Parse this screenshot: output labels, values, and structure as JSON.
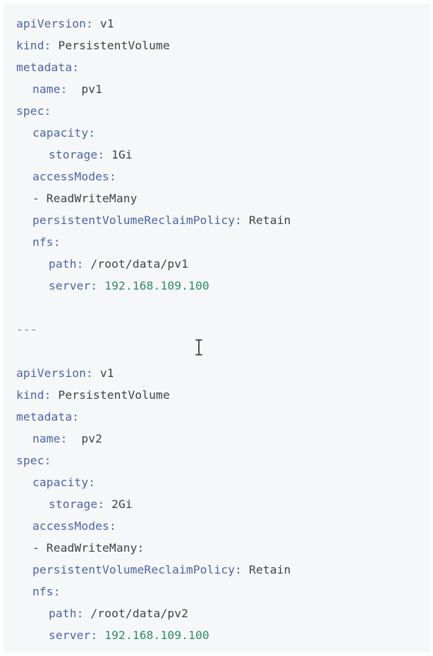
{
  "documents": [
    {
      "lines": [
        {
          "indent": 0,
          "key": "apiVersion",
          "sep": ": ",
          "value": "v1",
          "value_kind": "text"
        },
        {
          "indent": 0,
          "key": "kind",
          "sep": ": ",
          "value": "PersistentVolume",
          "value_kind": "text"
        },
        {
          "indent": 0,
          "key": "metadata",
          "sep": ":",
          "value": "",
          "value_kind": "text"
        },
        {
          "indent": 1,
          "key": "name",
          "sep": ":  ",
          "value": "pv1",
          "value_kind": "text"
        },
        {
          "indent": 0,
          "key": "spec",
          "sep": ":",
          "value": "",
          "value_kind": "text"
        },
        {
          "indent": 1,
          "key": "capacity",
          "sep": ":",
          "value": "",
          "value_kind": "text"
        },
        {
          "indent": 2,
          "key": "storage",
          "sep": ": ",
          "value": "1Gi",
          "value_kind": "text"
        },
        {
          "indent": 1,
          "key": "accessModes",
          "sep": ":",
          "value": "",
          "value_kind": "text"
        },
        {
          "indent": 1,
          "key": "",
          "sep": "",
          "value": "- ReadWriteMany",
          "value_kind": "text"
        },
        {
          "indent": 1,
          "key": "persistentVolumeReclaimPolicy",
          "sep": ": ",
          "value": "Retain",
          "value_kind": "text"
        },
        {
          "indent": 1,
          "key": "nfs",
          "sep": ":",
          "value": "",
          "value_kind": "text"
        },
        {
          "indent": 2,
          "key": "path",
          "sep": ": ",
          "value": "/root/data/pv1",
          "value_kind": "text"
        },
        {
          "indent": 2,
          "key": "server",
          "sep": ": ",
          "value": "192.168.109.100",
          "value_kind": "number"
        }
      ]
    },
    {
      "lines": [
        {
          "indent": 0,
          "key": "apiVersion",
          "sep": ": ",
          "value": "v1",
          "value_kind": "text"
        },
        {
          "indent": 0,
          "key": "kind",
          "sep": ": ",
          "value": "PersistentVolume",
          "value_kind": "text"
        },
        {
          "indent": 0,
          "key": "metadata",
          "sep": ":",
          "value": "",
          "value_kind": "text"
        },
        {
          "indent": 1,
          "key": "name",
          "sep": ":  ",
          "value": "pv2",
          "value_kind": "text"
        },
        {
          "indent": 0,
          "key": "spec",
          "sep": ":",
          "value": "",
          "value_kind": "text"
        },
        {
          "indent": 1,
          "key": "capacity",
          "sep": ":",
          "value": "",
          "value_kind": "text"
        },
        {
          "indent": 2,
          "key": "storage",
          "sep": ": ",
          "value": "2Gi",
          "value_kind": "text"
        },
        {
          "indent": 1,
          "key": "accessModes",
          "sep": ":",
          "value": "",
          "value_kind": "text"
        },
        {
          "indent": 1,
          "key": "",
          "sep": "",
          "value": "- ReadWriteMany:",
          "value_kind": "text"
        },
        {
          "indent": 1,
          "key": "persistentVolumeReclaimPolicy",
          "sep": ": ",
          "value": "Retain",
          "value_kind": "text"
        },
        {
          "indent": 1,
          "key": "nfs",
          "sep": ":",
          "value": "",
          "value_kind": "text"
        },
        {
          "indent": 2,
          "key": "path",
          "sep": ": ",
          "value": "/root/data/pv2",
          "value_kind": "text"
        },
        {
          "indent": 2,
          "key": "server",
          "sep": ": ",
          "value": "192.168.109.100",
          "value_kind": "number"
        }
      ]
    }
  ],
  "document_separator": "---",
  "colors": {
    "key": "#4a64a8",
    "value": "#3c4449",
    "number": "#2d8c5f",
    "separator": "#6f86c4",
    "background": "#f6f7f8"
  },
  "cursor_icon": "text-cursor-icon"
}
